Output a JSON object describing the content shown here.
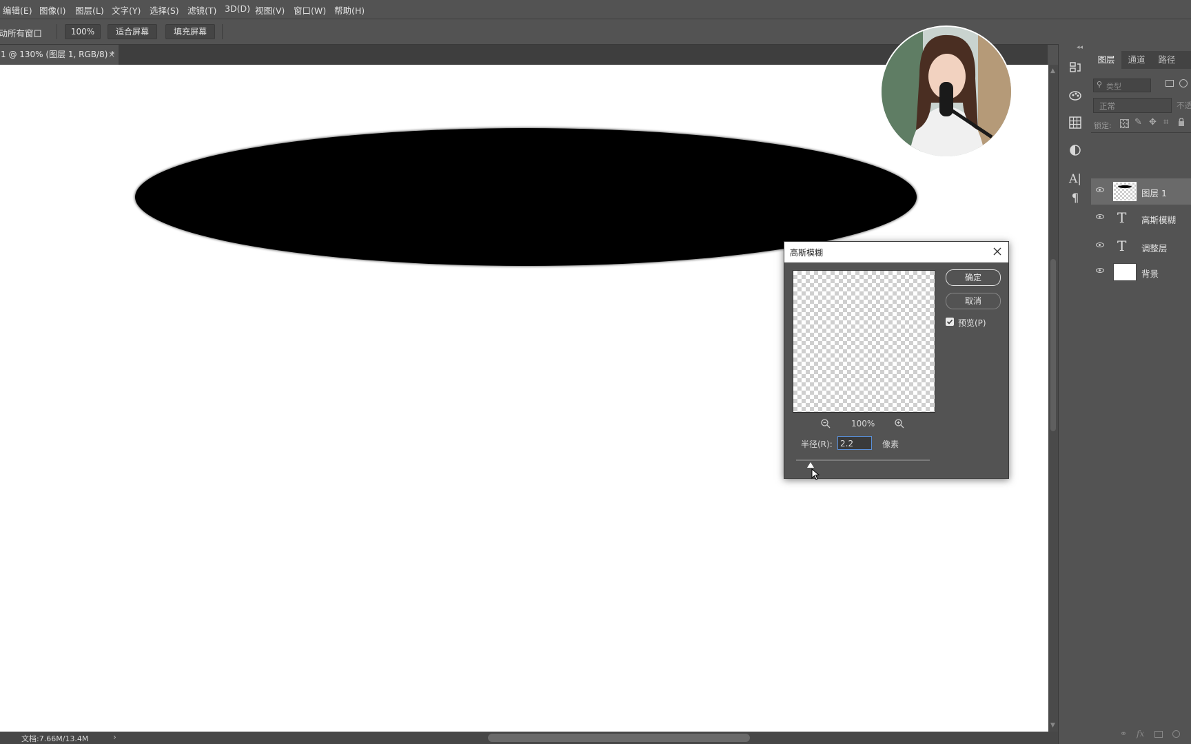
{
  "menu": [
    "编辑(E)",
    "图像(I)",
    "图层(L)",
    "文字(Y)",
    "选择(S)",
    "滤镜(T)",
    "3D(D)",
    "视图(V)",
    "窗口(W)",
    "帮助(H)"
  ],
  "options": {
    "scroll_all_label": "滚动所有窗口",
    "zoom_value": "100%",
    "fit_screen": "适合屏幕",
    "fill_screen": "填充屏幕"
  },
  "document_tab": {
    "title": "1 @ 130% (图层 1, RGB/8) *",
    "close": "×"
  },
  "status": {
    "doc_info": "文档:7.66M/13.4M",
    "arrow": "›"
  },
  "layers_panel": {
    "tabs": [
      "图层",
      "通道",
      "路径"
    ],
    "search_placeholder": "类型",
    "blend_mode": "正常",
    "opacity_label": "不透",
    "lock_label": "锁定:",
    "layers": [
      {
        "name": "图层 1",
        "type": "pixel",
        "selected": true
      },
      {
        "name": "高斯模糊",
        "type": "text",
        "selected": false
      },
      {
        "name": "调整层",
        "type": "text",
        "selected": false
      },
      {
        "name": "背景",
        "type": "background",
        "selected": false
      }
    ]
  },
  "dialog": {
    "title": "高斯模糊",
    "ok": "确定",
    "cancel": "取消",
    "preview_label": "预览(P)",
    "preview_checked": true,
    "zoom": "100%",
    "radius_label": "半径(R):",
    "radius_value": "2.2",
    "unit": "像素"
  },
  "colors": {
    "ui_bg": "#535353",
    "canvas": "#ffffff",
    "shape": "#000000"
  }
}
